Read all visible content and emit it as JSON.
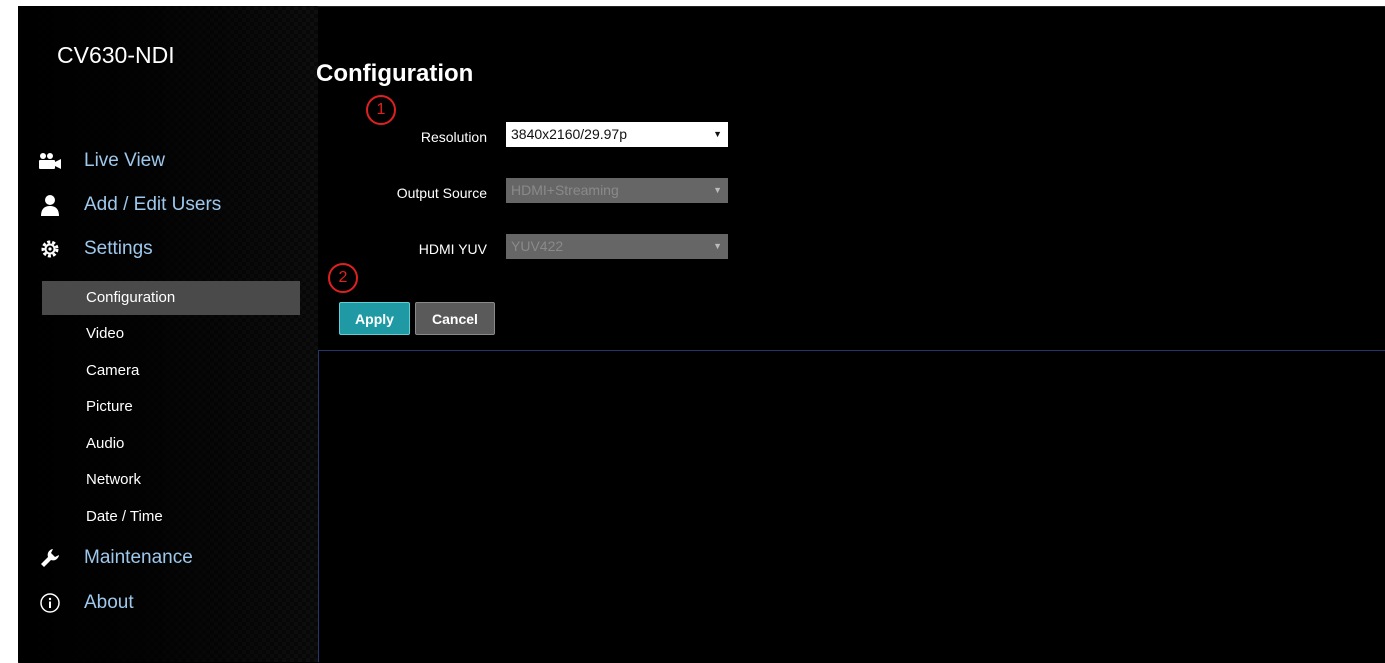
{
  "app": {
    "title": "CV630-NDI"
  },
  "sidebar": {
    "main_items": [
      {
        "label": "Live View",
        "icon": "camera-icon"
      },
      {
        "label": "Add / Edit Users",
        "icon": "user-icon"
      },
      {
        "label": "Settings",
        "icon": "gear-icon"
      },
      {
        "label": "Maintenance",
        "icon": "wrench-icon"
      },
      {
        "label": "About",
        "icon": "info-icon"
      }
    ],
    "settings_items": [
      {
        "label": "Configuration",
        "active": true
      },
      {
        "label": "Video"
      },
      {
        "label": "Camera"
      },
      {
        "label": "Picture"
      },
      {
        "label": "Audio"
      },
      {
        "label": "Network"
      },
      {
        "label": "Date / Time"
      }
    ]
  },
  "main": {
    "title": "Configuration",
    "fields": [
      {
        "label": "Resolution",
        "value": "3840x2160/29.97p",
        "enabled": true
      },
      {
        "label": "Output Source",
        "value": "HDMI+Streaming",
        "enabled": false
      },
      {
        "label": "HDMI YUV",
        "value": "YUV422",
        "enabled": false
      }
    ],
    "buttons": {
      "apply": "Apply",
      "cancel": "Cancel"
    },
    "annotations": [
      "1",
      "2"
    ]
  },
  "colors": {
    "nav_text": "#9ec8ec",
    "apply_button": "#1f9aa4",
    "active_item": "#4a4a4a",
    "annotation": "#e02020"
  }
}
